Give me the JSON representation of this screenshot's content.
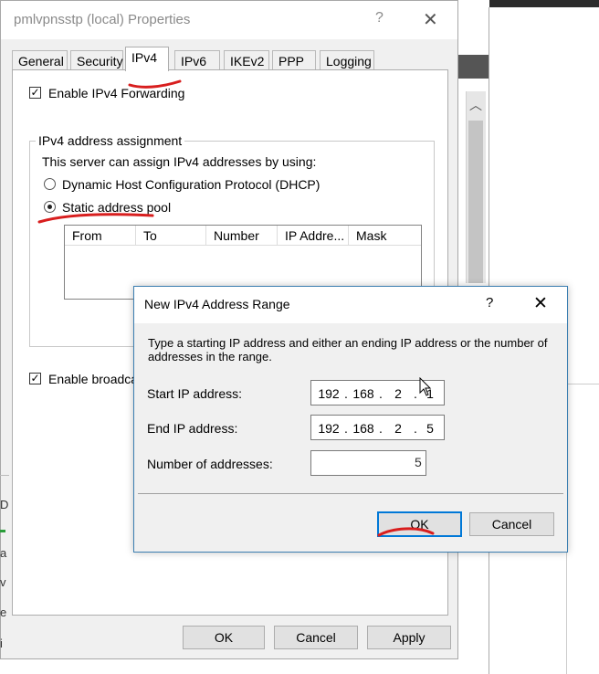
{
  "main_dialog": {
    "title": "pmlvpnsstp (local) Properties",
    "help_glyph": "?",
    "close_glyph": "✕",
    "tabs": [
      {
        "label": "General"
      },
      {
        "label": "Security"
      },
      {
        "label": "IPv4"
      },
      {
        "label": "IPv6"
      },
      {
        "label": "IKEv2"
      },
      {
        "label": "PPP"
      },
      {
        "label": "Logging"
      }
    ],
    "active_tab": "IPv4",
    "enable_forwarding_label": "Enable IPv4 Forwarding",
    "enable_forwarding_checked": true,
    "group_title": "IPv4 address assignment",
    "assign_text": "This server can assign IPv4 addresses by using:",
    "dhcp_label": "Dynamic Host Configuration Protocol (DHCP)",
    "static_label": "Static address pool",
    "selected_option": "static",
    "pool_columns": [
      "From",
      "To",
      "Number",
      "IP Addre...",
      "Mask"
    ],
    "enable_broadcast_label": "Enable broadca",
    "enable_broadcast_checked": true,
    "buttons": {
      "ok": "OK",
      "cancel": "Cancel",
      "apply": "Apply"
    }
  },
  "range_dialog": {
    "title": "New IPv4 Address Range",
    "help_glyph": "?",
    "close_glyph": "✕",
    "description": "Type a starting IP address and either an ending IP address or the number of addresses in the range.",
    "start_label": "Start IP address:",
    "start_ip": [
      "192",
      "168",
      "2",
      "1"
    ],
    "end_label": "End IP address:",
    "end_ip": [
      "192",
      "168",
      "2",
      "5"
    ],
    "count_label": "Number of addresses:",
    "count_value": "5",
    "buttons": {
      "ok": "OK",
      "cancel": "Cancel"
    }
  },
  "background": {
    "scroll_up_glyph": "︿",
    "left_fragments": [
      "a",
      "v",
      "e",
      "i",
      "D"
    ]
  },
  "colors": {
    "annotation_red": "#d81e1e",
    "focus_blue": "#0078d7",
    "dialog_bg": "#f0f0f0",
    "button_bg": "#e1e1e1"
  }
}
